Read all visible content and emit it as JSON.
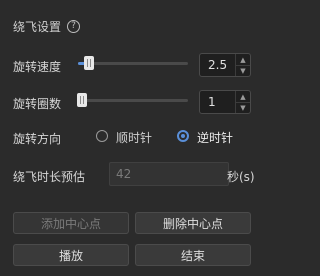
{
  "panel": {
    "title": "绕飞设置",
    "help_icon": "?"
  },
  "speed": {
    "label": "旋转速度",
    "value": "2.5",
    "slider_level": 0.07
  },
  "circles": {
    "label": "旋转圈数",
    "value": "1",
    "slider_level": 0.0
  },
  "direction": {
    "label": "旋转方向",
    "options": [
      "顺时针",
      "逆时针"
    ],
    "selected": "逆时针"
  },
  "estimate": {
    "label": "绕飞时长预估",
    "value": "42",
    "unit": "秒(s)"
  },
  "buttons": {
    "add_center": "添加中心点",
    "delete_center": "删除中心点",
    "play": "播放",
    "end": "结束"
  },
  "colors": {
    "accent": "#5a8fd8",
    "background": "#2b2b2b"
  }
}
